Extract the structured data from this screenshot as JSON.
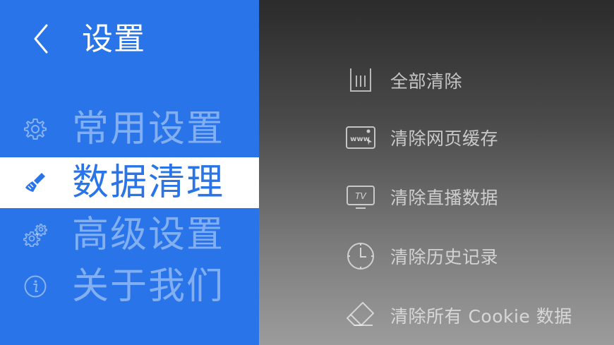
{
  "header": {
    "title": "设置",
    "back_icon": "chevron-left-icon"
  },
  "sidebar": {
    "items": [
      {
        "label": "常用设置",
        "icon": "gear-icon",
        "active": false
      },
      {
        "label": "数据清理",
        "icon": "broom-icon",
        "active": true
      },
      {
        "label": "高级设置",
        "icon": "gears-icon",
        "active": false
      },
      {
        "label": "关于我们",
        "icon": "info-icon",
        "active": false
      }
    ]
  },
  "panel": {
    "options": [
      {
        "label": "全部清除",
        "icon": "trash-icon"
      },
      {
        "label": "清除网页缓存",
        "icon": "www-icon"
      },
      {
        "label": "清除直播数据",
        "icon": "tv-icon"
      },
      {
        "label": "清除历史记录",
        "icon": "clock-icon"
      },
      {
        "label": "清除所有 Cookie 数据",
        "icon": "eraser-icon"
      }
    ]
  },
  "colors": {
    "sidebar_bg": "#2874e8",
    "active_bg": "#ffffff",
    "active_text": "#2874e8"
  }
}
